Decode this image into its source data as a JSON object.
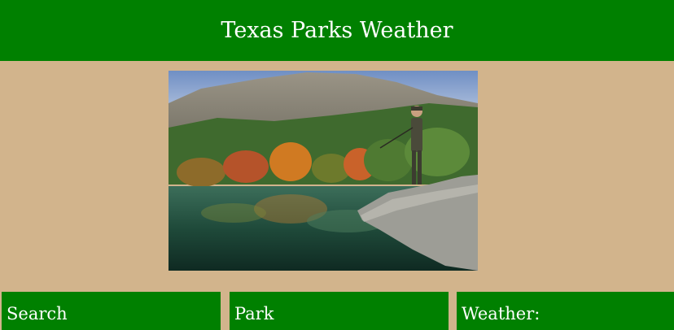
{
  "header": {
    "title": "Texas Parks Weather"
  },
  "hero": {
    "image": "river-landscape-with-fisherman"
  },
  "panels": [
    {
      "label": "Search"
    },
    {
      "label": "Park"
    },
    {
      "label": "Weather:"
    }
  ],
  "colors": {
    "header_bg": "#008000",
    "page_bg": "#d2b48c",
    "text": "#ffffff"
  }
}
